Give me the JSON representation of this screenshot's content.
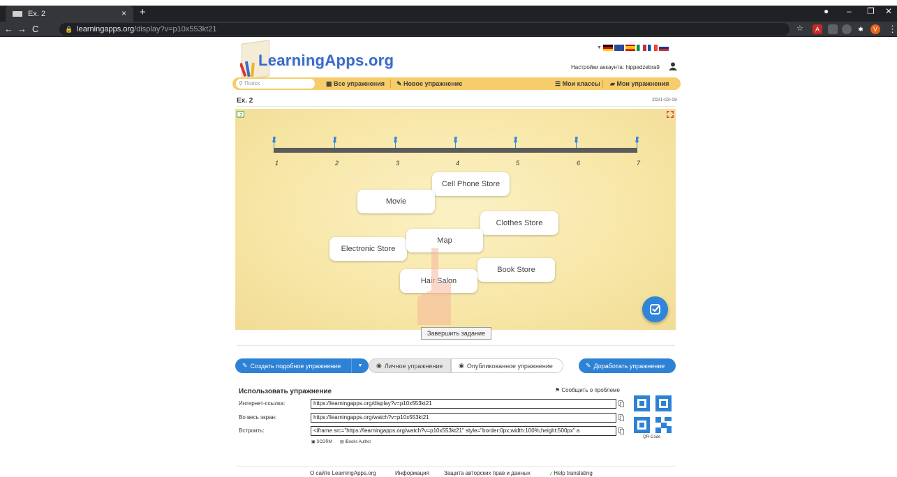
{
  "browser": {
    "tab_title": "Ex. 2",
    "tab_close": "×",
    "new_tab": "+",
    "url_host": "learningapps.org",
    "url_path": "/display?v=p10x553kt21",
    "win_min": "–",
    "win_max": "❐",
    "win_close": "✕"
  },
  "site": {
    "logo": "LearningApps.org",
    "account_settings": "Настройки аккаунта: hippedzebra9",
    "search_placeholder": "Поиск",
    "nav": {
      "all": "Все упражнения",
      "new": "Новое упражнение",
      "classes": "Мои классы",
      "mine": "Мои упражнения"
    }
  },
  "exercise": {
    "title": "Ex. 2",
    "date": "2021-03-19",
    "timeline_numbers": [
      "1",
      "2",
      "3",
      "4",
      "5",
      "6",
      "7"
    ],
    "items": [
      "Cell Phone Store",
      "Movie",
      "Clothes Store",
      "Map",
      "Electronic Store",
      "Book Store",
      "Hair Salon"
    ],
    "finish_button": "Завершить задание"
  },
  "actions": {
    "create_similar": "Создать подобное упражнение",
    "dropdown": "▼",
    "private": "Личное упражнение",
    "published": "Опубликованное упражнение",
    "refine": "Доработать упражнение"
  },
  "use": {
    "title": "Использовать упражнение",
    "report": "Сообщить о проблеме",
    "rows": [
      {
        "label": "Интернет-ссылка:",
        "value": "https://learningapps.org/display?v=p10x553kt21"
      },
      {
        "label": "Во весь экран:",
        "value": "https://learningapps.org/watch?v=p10x553kt21"
      },
      {
        "label": "Встроить:",
        "value": "<iframe src=\"https://learningapps.org/watch?v=p10x553kt21\" style=\"border:0px;width:100%;height:500px\" a"
      }
    ],
    "scorm": "SCORM",
    "ibooks": "iBooks Author",
    "qr_label": "QR-Code"
  },
  "footer": {
    "about": "О сайте LearningApps.org",
    "info": "Информация",
    "privacy": "Защита авторских прав и данных",
    "translate": "Help translating"
  },
  "colors": {
    "nav_strip": "#f6cd6a",
    "board": "#f7e6a6",
    "accent_blue": "#2e82d6",
    "logo_blue": "#3a6bc9"
  }
}
